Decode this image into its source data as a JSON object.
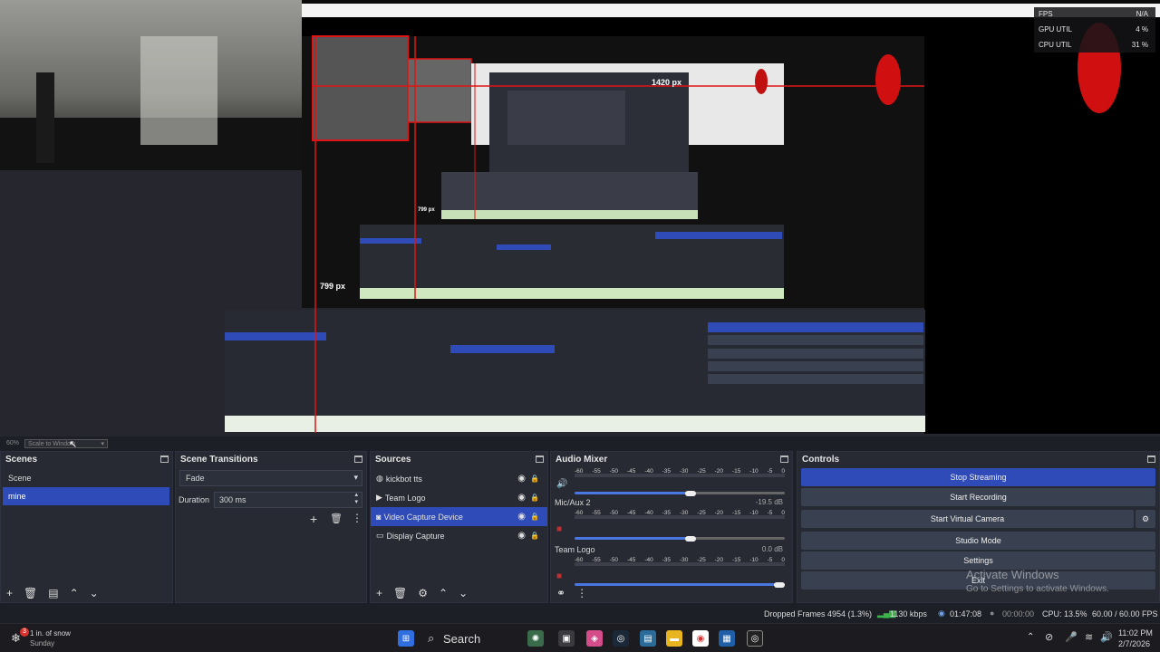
{
  "preview": {
    "hud": {
      "fps_label": "FPS",
      "fps_value": "N/A",
      "gpu_label": "GPU UTIL",
      "gpu_value": "4 %",
      "cpu_label": "CPU UTIL",
      "cpu_value": "31 %"
    },
    "label_1420": "1420 px",
    "label_799a": "799 px",
    "label_799b": "799 px"
  },
  "scale": {
    "zoom": "60%",
    "mode": "Scale to Window"
  },
  "scenes": {
    "title": "Scenes",
    "items": [
      {
        "label": "Scene"
      },
      {
        "label": "mine",
        "selected": true
      }
    ]
  },
  "transitions": {
    "title": "Scene Transitions",
    "type": "Fade",
    "duration_label": "Duration",
    "duration_value": "300 ms"
  },
  "sources": {
    "title": "Sources",
    "items": [
      {
        "label": "kickbot tts",
        "icon": "globe-icon"
      },
      {
        "label": "Team Logo",
        "icon": "play-icon"
      },
      {
        "label": "Video Capture Device",
        "icon": "camera-icon",
        "selected": true
      },
      {
        "label": "Display Capture",
        "icon": "monitor-icon"
      }
    ]
  },
  "mixer": {
    "title": "Audio Mixer",
    "ticks": [
      "-60",
      "-55",
      "-50",
      "-45",
      "-40",
      "-35",
      "-30",
      "-25",
      "-20",
      "-15",
      "-10",
      "-5",
      "0"
    ],
    "channels": [
      {
        "name": "",
        "db": ""
      },
      {
        "name": "Mic/Aux 2",
        "db": "-19.5 dB"
      },
      {
        "name": "Team Logo",
        "db": "0.0 dB"
      }
    ]
  },
  "controls": {
    "title": "Controls",
    "stop_streaming": "Stop Streaming",
    "start_recording": "Start Recording",
    "start_virtual_camera": "Start Virtual Camera",
    "studio_mode": "Studio Mode",
    "settings": "Settings",
    "exit": "Exit"
  },
  "watermark": {
    "line1": "Activate Windows",
    "line2": "Go to Settings to activate Windows."
  },
  "status": {
    "dropped_frames": "Dropped Frames 4954 (1.3%)",
    "bitrate": "1130 kbps",
    "stream_time": "01:47:08",
    "record_time": "00:00:00",
    "cpu": "CPU: 13.5%",
    "fps": "60.00 / 60.00 FPS"
  },
  "taskbar": {
    "weather_temp": "1 in. of snow",
    "weather_day": "Sunday",
    "badge": "3",
    "search": "Search",
    "time": "11:02 PM",
    "date": "2/7/2026"
  },
  "colors": {
    "accent": "#2f4bb8",
    "dock_bg": "#272a33",
    "capture_red": "#e01414"
  }
}
